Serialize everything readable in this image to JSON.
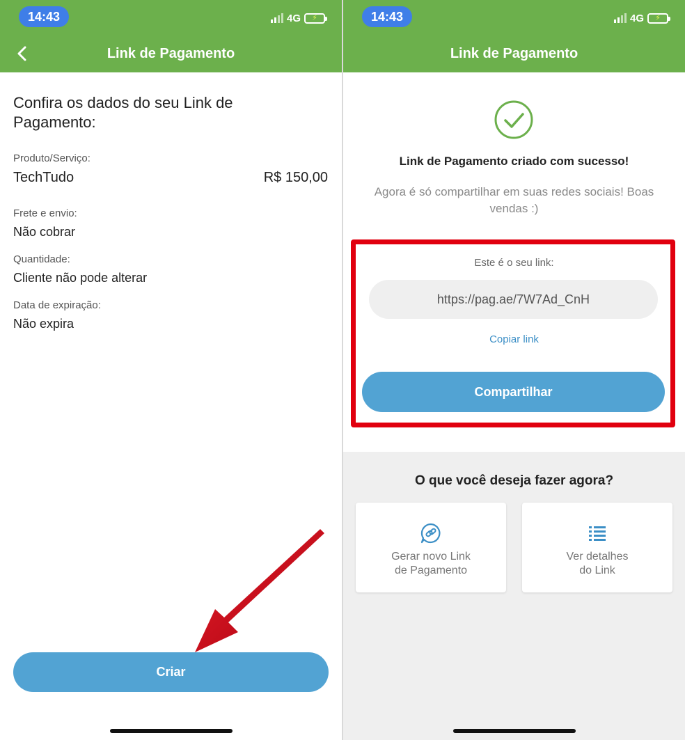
{
  "status_bar": {
    "time": "14:43",
    "network": "4G"
  },
  "header": {
    "title": "Link de Pagamento"
  },
  "confirm": {
    "title": "Confira os dados do seu Link de Pagamento:",
    "fields": [
      {
        "label": "Produto/Serviço:",
        "value": "TechTudo",
        "price": "R$ 150,00"
      },
      {
        "label": "Frete e envio:",
        "value": "Não cobrar"
      },
      {
        "label": "Quantidade:",
        "value": "Cliente não pode alterar"
      },
      {
        "label": "Data de expiração:",
        "value": "Não expira"
      }
    ],
    "create_label": "Criar"
  },
  "success": {
    "title": "Link de Pagamento criado com sucesso!",
    "subtitle": "Agora é só compartilhar em suas redes sociais! Boas vendas :)",
    "link_label": "Este é o seu link:",
    "link_url": "https://pag.ae/7W7Ad_CnH",
    "copy_label": "Copiar link",
    "share_label": "Compartilhar"
  },
  "next_steps": {
    "title": "O que você deseja fazer agora?",
    "cards": [
      {
        "label": "Gerar novo Link\nde Pagamento",
        "icon": "chat-link-icon"
      },
      {
        "label": "Ver detalhes\ndo Link",
        "icon": "list-icon"
      }
    ]
  },
  "colors": {
    "header_green": "#6cb04c",
    "button_blue": "#52a3d3",
    "highlight_red": "#e1000f",
    "time_pill_blue": "#3f7ee8",
    "success_green": "#6cb04c"
  }
}
